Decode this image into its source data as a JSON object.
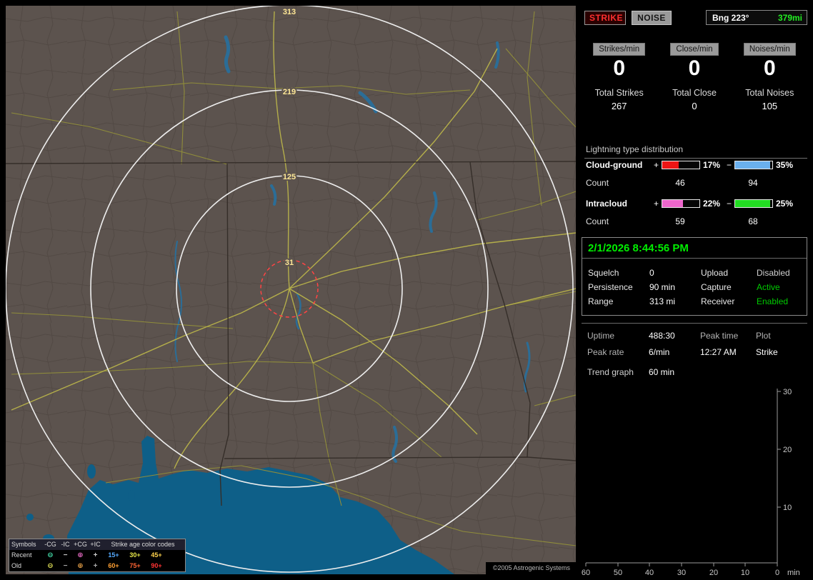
{
  "toolbar": {
    "strike_button": "STRIKE",
    "noise_button": "NOISE",
    "bearing_label": "Bng 223°",
    "distance_label": "379mi",
    "distance_color": "#22ee22"
  },
  "counters": [
    {
      "rate_label": "Strikes/min",
      "rate_value": "0",
      "total_label": "Total Strikes",
      "total_value": "267"
    },
    {
      "rate_label": "Close/min",
      "rate_value": "0",
      "total_label": "Total Close",
      "total_value": "0"
    },
    {
      "rate_label": "Noises/min",
      "rate_value": "0",
      "total_label": "Total Noises",
      "total_value": "105"
    }
  ],
  "distribution": {
    "title": "Lightning type distribution",
    "rows": [
      {
        "name": "Cloud-ground",
        "plus_sign": "+",
        "plus_fill": 45,
        "plus_color": "#ee1515",
        "plus_pct": "17%",
        "minus_sign": "−",
        "minus_fill": 94,
        "minus_color": "#6ab0ee",
        "minus_pct": "35%",
        "count_label": "Count",
        "plus_count": "46",
        "minus_count": "94"
      },
      {
        "name": "Intracloud",
        "plus_sign": "+",
        "plus_fill": 55,
        "plus_color": "#ee66cc",
        "plus_pct": "22%",
        "minus_sign": "−",
        "minus_fill": 94,
        "minus_color": "#22dd22",
        "minus_pct": "25%",
        "count_label": "Count",
        "plus_count": "59",
        "minus_count": "68"
      }
    ]
  },
  "status": {
    "datetime": "2/1/2026 8:44:56 PM",
    "datetime_color": "#00ee00",
    "rows": [
      {
        "label1": "Squelch",
        "value1": "0",
        "label2": "Upload",
        "value2": "Disabled",
        "value2_color": "#cfcfcf"
      },
      {
        "label1": "Persistence",
        "value1": "90 min",
        "label2": "Capture",
        "value2": "Active",
        "value2_color": "#00cc00"
      },
      {
        "label1": "Range",
        "value1": "313 mi",
        "label2": "Receiver",
        "value2": "Enabled",
        "value2_color": "#00cc00"
      }
    ]
  },
  "stats": {
    "uptime_label": "Uptime",
    "uptime_value": "488:30",
    "peak_time_label": "Peak time",
    "peak_time_value": "12:27 AM",
    "plot_label": "Plot",
    "plot_value": "Strike",
    "peak_rate_label": "Peak rate",
    "peak_rate_value": "6/min",
    "trend_label": "Trend graph",
    "trend_value": "60 min"
  },
  "trend_chart": {
    "type": "line",
    "series": [],
    "x_ticks": [
      "60",
      "50",
      "40",
      "30",
      "20",
      "10",
      "0"
    ],
    "x_unit": "min",
    "y_ticks": [
      "30",
      "20",
      "10"
    ]
  },
  "map": {
    "ring_labels": [
      "313",
      "219",
      "125",
      "31"
    ],
    "ring_label_color": "#ffe896",
    "copyright": "©2005 Astrogenic Systems",
    "legend": {
      "symbols_header": "Symbols",
      "col_headers": [
        "-CG",
        "-IC",
        "+CG",
        "+IC"
      ],
      "age_header": "Strike age color codes",
      "rows": [
        {
          "label": "Recent",
          "symbols": [
            {
              "glyph": "⊖",
              "color": "#44ddaa"
            },
            {
              "glyph": "−",
              "color": "#cccccc"
            },
            {
              "glyph": "⊕",
              "color": "#dd66bb"
            },
            {
              "glyph": "+",
              "color": "#cccccc"
            }
          ],
          "ages": [
            {
              "text": "15+",
              "color": "#55aaff"
            },
            {
              "text": "30+",
              "color": "#e8e84a"
            },
            {
              "text": "45+",
              "color": "#ffd24d"
            }
          ]
        },
        {
          "label": "Old",
          "symbols": [
            {
              "glyph": "⊖",
              "color": "#dddd55"
            },
            {
              "glyph": "−",
              "color": "#aaaaaa"
            },
            {
              "glyph": "⊕",
              "color": "#dd9944"
            },
            {
              "glyph": "+",
              "color": "#aaaaaa"
            }
          ],
          "ages": [
            {
              "text": "60+",
              "color": "#ffa033"
            },
            {
              "text": "75+",
              "color": "#ff6433"
            },
            {
              "text": "90+",
              "color": "#ff3333"
            }
          ]
        }
      ]
    }
  }
}
